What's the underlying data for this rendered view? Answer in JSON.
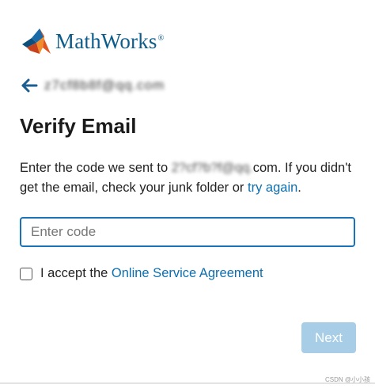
{
  "logo": {
    "name": "MathWorks",
    "reg": "®"
  },
  "back": {
    "email_obscured": "z7cf8b8f@qq.com"
  },
  "title": "Verify Email",
  "description": {
    "prefix": "Enter the code we sent to",
    "email_obscured": "2?cf?b?f@qq.",
    "email_suffix": "com. If you didn't get the email, check your junk folder or",
    "retry_link": "try again",
    "end": "."
  },
  "code_input": {
    "placeholder": "Enter code",
    "value": ""
  },
  "agreement": {
    "label_prefix": "I accept the",
    "link": "Online Service Agreement",
    "checked": false
  },
  "next_button": {
    "label": "Next",
    "color": "#a7cee6"
  },
  "watermark": "CSDN @小小孩",
  "colors": {
    "accent": "#0c6fb0",
    "logo_text": "#0c5d8c",
    "input_border": "#1a73b8"
  }
}
